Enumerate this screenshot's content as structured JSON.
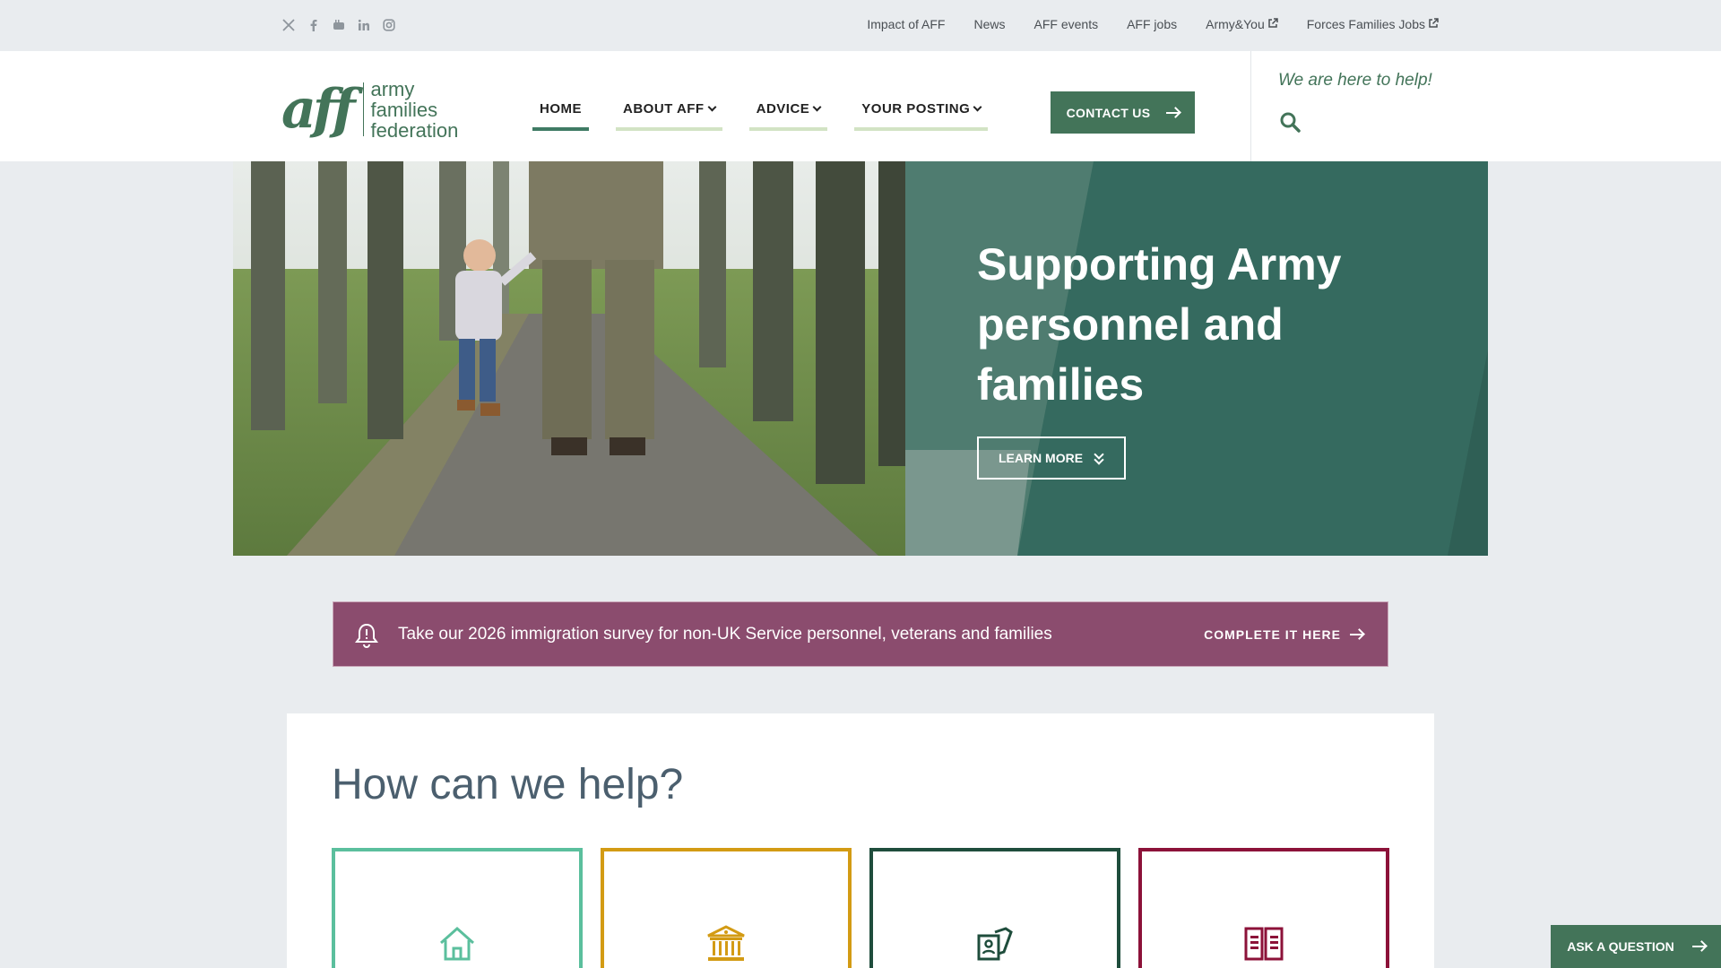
{
  "topbar": {
    "social": [
      "x-icon",
      "facebook-icon",
      "youtube-icon",
      "linkedin-icon",
      "instagram-icon"
    ],
    "links": [
      "Impact of AFF",
      "News",
      "AFF events",
      "AFF jobs",
      "Army&You",
      "Forces Families Jobs"
    ]
  },
  "header": {
    "logo_mark": "aff",
    "logo_lines": [
      "army",
      "families",
      "federation"
    ],
    "nav": [
      {
        "label": "HOME",
        "active": true
      },
      {
        "label": "ABOUT AFF",
        "dropdown": true
      },
      {
        "label": "ADVICE",
        "dropdown": true
      },
      {
        "label": "YOUR POSTING",
        "dropdown": true
      }
    ],
    "contact_label": "CONTACT US",
    "tagline": "We are here to help!"
  },
  "hero": {
    "title": "Supporting Army personnel and families",
    "button_label": "LEARN MORE"
  },
  "alert": {
    "text": "Take our 2026 immigration survey for non-UK Service personnel, veterans and families",
    "cta": "COMPLETE IT HERE"
  },
  "help": {
    "title": "How can we help?",
    "cards": [
      {
        "icon": "house-icon",
        "color": "#5bbf9d"
      },
      {
        "icon": "bank-icon",
        "color": "#d39b14"
      },
      {
        "icon": "id-card-pen-icon",
        "color": "#1f4d3c"
      },
      {
        "icon": "book-icon",
        "color": "#8c1239"
      }
    ]
  },
  "ask_label": "ASK A QUESTION",
  "colors": {
    "brand_green": "#437459",
    "hero_panel": "#356a5f",
    "alert_plum": "#8b4c6e",
    "page_bg": "#e9ecef"
  }
}
